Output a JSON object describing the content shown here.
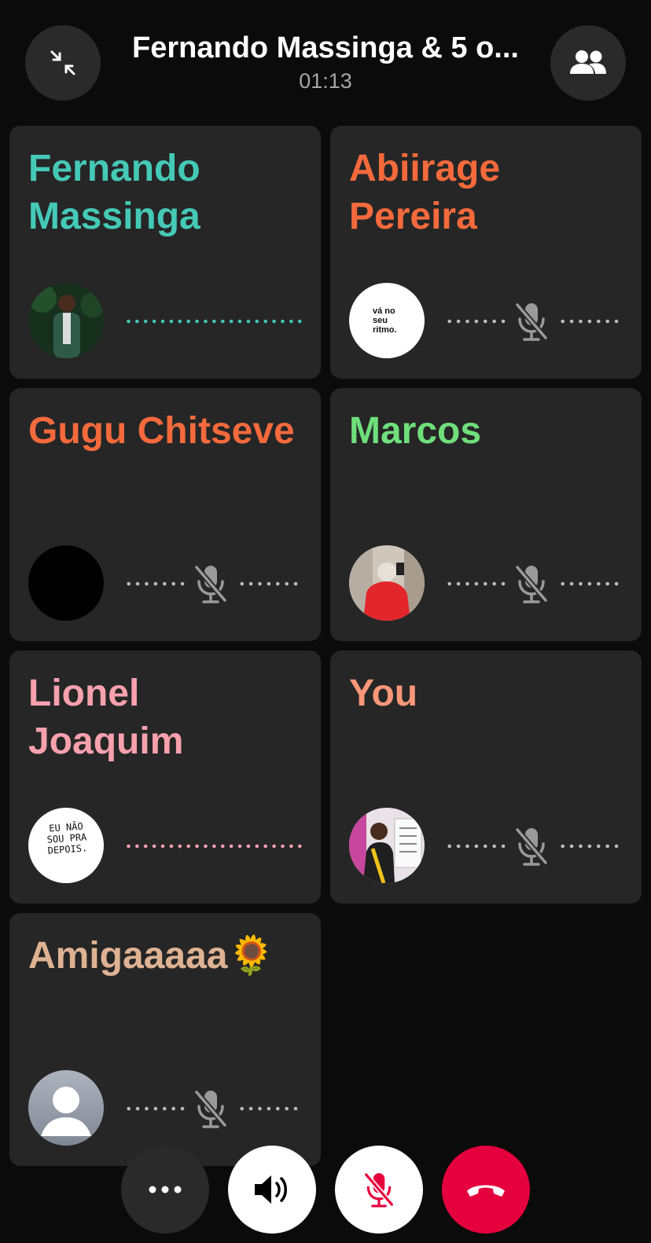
{
  "call": {
    "title": "Fernando Massinga & 5 o...",
    "timer": "01:13"
  },
  "header": {
    "minimize_icon": "shrink-arrows-icon",
    "participants_icon": "people-icon"
  },
  "participants": [
    {
      "name": "Fernando Massinga",
      "color": "#45c9b7",
      "muted": false,
      "speaking": true,
      "avatar": "photo-man-in-suit"
    },
    {
      "name": "Abiirage Pereira",
      "color": "#f46a3c",
      "muted": true,
      "speaking": false,
      "avatar_text": "vá no seu ritmo."
    },
    {
      "name": "Gugu Chitseve",
      "color": "#f46a3c",
      "muted": true,
      "speaking": false,
      "avatar": "black-circle"
    },
    {
      "name": "Marcos",
      "color": "#6fdf7b",
      "muted": true,
      "speaking": false,
      "avatar": "photo-red-hoodie"
    },
    {
      "name": "Lionel Joaquim",
      "color": "#f7a1ad",
      "muted": false,
      "speaking": true,
      "avatar_text": "EU NÃO SOU PRA DEPOIS."
    },
    {
      "name": "You",
      "color": "#fb9779",
      "muted": true,
      "speaking": false,
      "avatar": "photo-man-presenting"
    },
    {
      "name": "Amigaaaaa🌻",
      "color": "#deb292",
      "muted": true,
      "speaking": false,
      "avatar": "default-person-icon"
    }
  ],
  "controls": {
    "more_icon": "more-dots-icon",
    "speaker_icon": "speaker-icon",
    "mic_icon": "mic-muted-icon",
    "end_call_icon": "end-call-icon",
    "end_call_color": "#e5003e"
  }
}
